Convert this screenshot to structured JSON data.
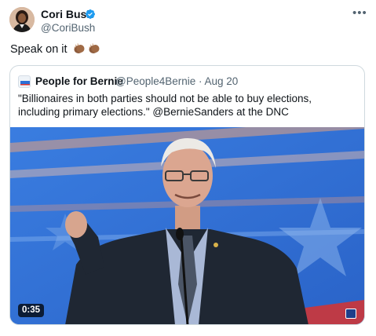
{
  "tweet": {
    "author_name": "Cori Bush",
    "author_handle": "@CoriBush",
    "more_icon": "more-horizontal-icon",
    "text": "Speak on it",
    "emoji": [
      "clapping-hands-medium-dark",
      "clapping-hands-medium-dark"
    ],
    "verified_color": "#1d9bf0"
  },
  "quote": {
    "author_name": "People for Bernie",
    "author_handle": "@People4Bernie · Aug 20",
    "text": "\"Billionaires in both parties should not be able to buy elections, including primary elections.\" @BernieSanders at the DNC",
    "video": {
      "duration": "0:35",
      "background_color": "#2d6fd6"
    }
  }
}
